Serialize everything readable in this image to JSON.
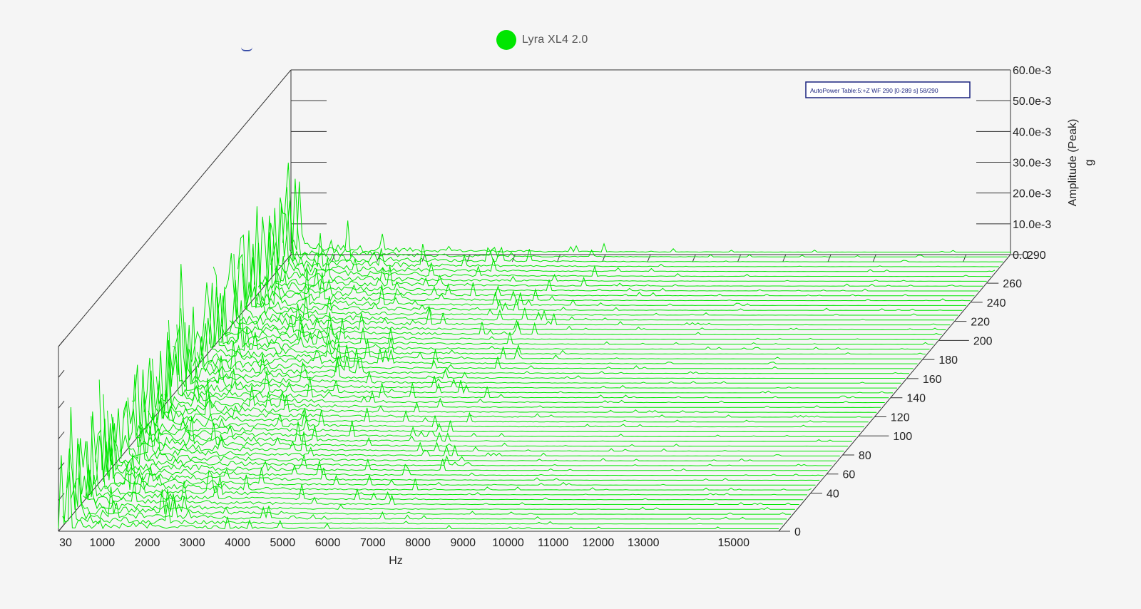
{
  "legend": {
    "label": "Lyra XL4 2.0",
    "color": "#00e600"
  },
  "annotation": "AutoPower Table:5:+Z WF 290 [0-289 s]  58/290",
  "chart_data": {
    "type": "waterfall",
    "title": "",
    "xlabel": "Hz",
    "ylabel": "Amplitude (Peak)",
    "yunit": "g",
    "zlabel": "",
    "x_ticks": [
      "30",
      "1000",
      "2000",
      "3000",
      "4000",
      "5000",
      "6000",
      "7000",
      "8000",
      "9000",
      "10000",
      "11000",
      "12000",
      "13000",
      "15000"
    ],
    "y_ticks": [
      "0.0",
      "10.0e-3",
      "20.0e-3",
      "30.0e-3",
      "40.0e-3",
      "50.0e-3",
      "60.0e-3"
    ],
    "z_ticks": [
      "0",
      "40",
      "60",
      "80",
      "100",
      "120",
      "140",
      "160",
      "180",
      "200",
      "220",
      "240",
      "260",
      "290"
    ],
    "xlim": [
      30,
      16000
    ],
    "ylim": [
      0,
      0.06
    ],
    "zlim": [
      0,
      290
    ],
    "slices": 58,
    "series_color": "#00e600",
    "grid": false
  }
}
